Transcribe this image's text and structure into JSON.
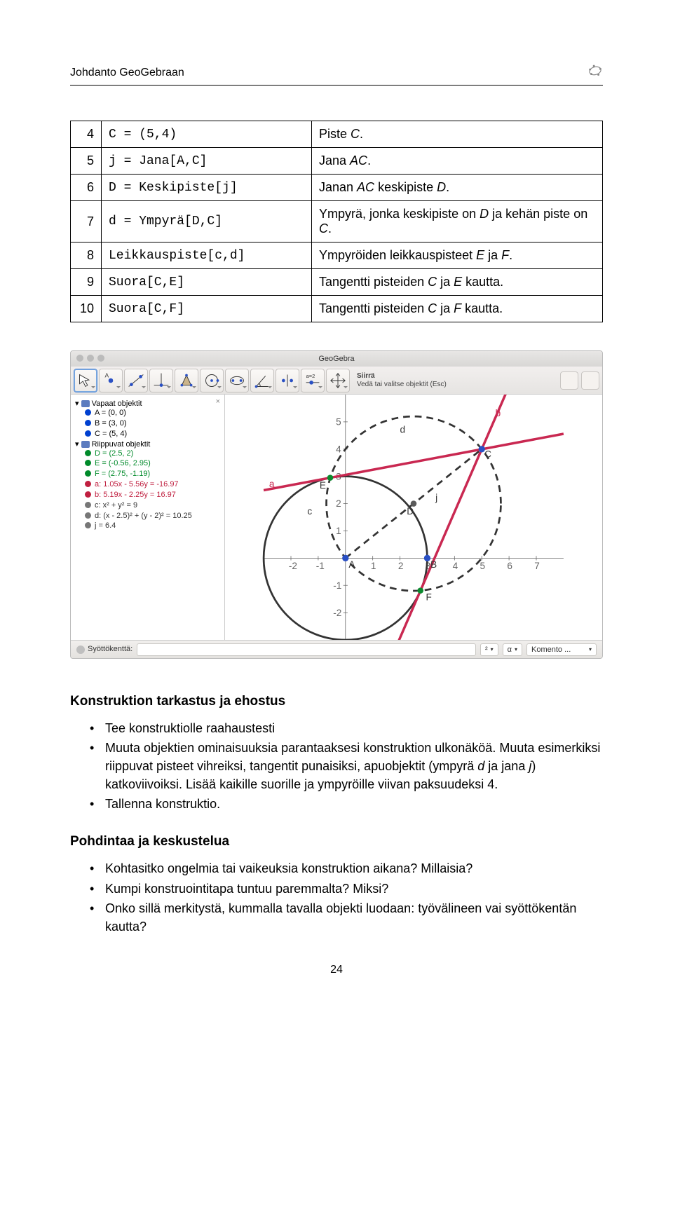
{
  "header": {
    "title": "Johdanto GeoGebraan"
  },
  "table": {
    "rows": [
      {
        "n": "4",
        "code": "C = (5,4)",
        "desc_pre": "Piste ",
        "desc_it": "C",
        "desc_post": "."
      },
      {
        "n": "5",
        "code": "j = Jana[A,C]",
        "desc_pre": "Jana ",
        "desc_it": "AC",
        "desc_post": "."
      },
      {
        "n": "6",
        "code": "D = Keskipiste[j]",
        "desc_pre": "Janan ",
        "desc_it": "AC",
        "desc_post": " keskipiste ",
        "desc_it2": "D",
        "desc_post2": "."
      },
      {
        "n": "7",
        "code": "d = Ympyrä[D,C]",
        "desc_pre": "Ympyrä, jonka keskipiste on ",
        "desc_it": "D",
        "desc_post": " ja kehän piste on ",
        "desc_it2": "C",
        "desc_post2": "."
      },
      {
        "n": "8",
        "code": "Leikkauspiste[c,d]",
        "desc_pre": "Ympyröiden leikkauspisteet ",
        "desc_it": "E",
        "desc_post": " ja ",
        "desc_it2": "F",
        "desc_post2": "."
      },
      {
        "n": "9",
        "code": "Suora[C,E]",
        "desc_pre": "Tangentti pisteiden ",
        "desc_it": "C",
        "desc_post": " ja ",
        "desc_it2": "E",
        "desc_post2": " kautta."
      },
      {
        "n": "10",
        "code": "Suora[C,F]",
        "desc_pre": "Tangentti pisteiden ",
        "desc_it": "C",
        "desc_post": " ja ",
        "desc_it2": "F",
        "desc_post2": " kautta."
      }
    ]
  },
  "screenshot": {
    "title": "GeoGebra",
    "hint1": "Siirrä",
    "hint2": "Vedä tai valitse objektit (Esc)",
    "alg": {
      "folder1": "Vapaat objektit",
      "items1": [
        "A = (0, 0)",
        "B = (3, 0)",
        "C = (5, 4)"
      ],
      "folder2": "Riippuvat objektit",
      "items2": [
        {
          "t": "D = (2.5, 2)",
          "cls": "green c-grn"
        },
        {
          "t": "E = (-0.56, 2.95)",
          "cls": "green c-grn"
        },
        {
          "t": "F = (2.75, -1.19)",
          "cls": "green c-grn"
        },
        {
          "t": "a: 1.05x - 5.56y = -16.97",
          "cls": "red c-red"
        },
        {
          "t": "b: 5.19x - 2.25y = 16.97",
          "cls": "red c-red"
        },
        {
          "t": "c: x² + y² = 9",
          "cls": "grey c-grey"
        },
        {
          "t": "d: (x - 2.5)² + (y - 2)² = 10.25",
          "cls": "grey c-grey"
        },
        {
          "t": "j = 6.4",
          "cls": "grey c-grey"
        }
      ]
    },
    "footer": {
      "label": "Syöttökenttä:",
      "sel1": "²",
      "sel2": "α",
      "sel3": "Komento ..."
    }
  },
  "section1": {
    "title": "Konstruktion tarkastus ja ehostus",
    "b1": "Tee konstruktiolle raahaustesti",
    "b2": "Muuta objektien ominaisuuksia parantaaksesi konstruktion ulkonäköä. Muuta esimerkiksi riippuvat pisteet vihreiksi, tangentit punaisiksi, apuobjektit (ympyrä ",
    "b2_it1": "d",
    "b2_mid": " ja jana ",
    "b2_it2": "j",
    "b2_post": ") katkoviivoiksi. Lisää kaikille suorille ja ympyröille viivan paksuudeksi 4.",
    "b3": "Tallenna konstruktio."
  },
  "section2": {
    "title": "Pohdintaa ja keskustelua",
    "b1": "Kohtasitko ongelmia tai vaikeuksia konstruktion aikana? Millaisia?",
    "b2": "Kumpi konstruointitapa tuntuu paremmalta? Miksi?",
    "b3": "Onko sillä merkitystä, kummalla tavalla objekti luodaan: työvälineen vai syöttökentän kautta?"
  },
  "pagenum": "24",
  "chart_data": {
    "type": "scatter",
    "title": "Tangent lines from external point to circle",
    "xlim": [
      -2,
      7
    ],
    "ylim": [
      -2,
      5
    ],
    "series": [
      {
        "name": "A",
        "x": 0,
        "y": 0
      },
      {
        "name": "B",
        "x": 3,
        "y": 0
      },
      {
        "name": "C",
        "x": 5,
        "y": 4
      },
      {
        "name": "D",
        "x": 2.5,
        "y": 2
      },
      {
        "name": "E",
        "x": -0.56,
        "y": 2.95
      },
      {
        "name": "F",
        "x": 2.75,
        "y": -1.19
      }
    ],
    "circles": [
      {
        "name": "c",
        "cx": 0,
        "cy": 0,
        "r": 3,
        "style": "solid"
      },
      {
        "name": "d",
        "cx": 2.5,
        "cy": 2,
        "r": 3.2,
        "style": "dashed"
      }
    ],
    "lines": [
      {
        "name": "a",
        "eq": "1.05x - 5.56y = -16.97",
        "color": "red"
      },
      {
        "name": "b",
        "eq": "5.19x - 2.25y = 16.97",
        "color": "red"
      },
      {
        "name": "j",
        "from": "A",
        "to": "C",
        "len": 6.4,
        "style": "dashed"
      }
    ]
  }
}
